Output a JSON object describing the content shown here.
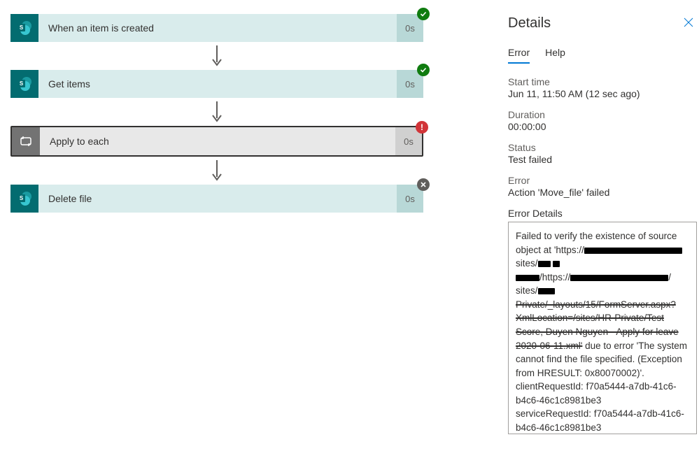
{
  "flow": {
    "steps": [
      {
        "label": "When an item is created",
        "time": "0s",
        "status": "success",
        "icon": "sharepoint"
      },
      {
        "label": "Get items",
        "time": "0s",
        "status": "success",
        "icon": "sharepoint"
      },
      {
        "label": "Apply to each",
        "time": "0s",
        "status": "error",
        "icon": "loop",
        "selected": true
      },
      {
        "label": "Delete file",
        "time": "0s",
        "status": "skipped",
        "icon": "sharepoint"
      }
    ]
  },
  "details": {
    "title": "Details",
    "tabs": {
      "error": "Error",
      "help": "Help",
      "selected": "error"
    },
    "start_time": {
      "label": "Start time",
      "value": "Jun 11, 11:50 AM (12 sec ago)"
    },
    "duration": {
      "label": "Duration",
      "value": "00:00:00"
    },
    "status": {
      "label": "Status",
      "value": "Test failed"
    },
    "error": {
      "label": "Error",
      "value": "Action 'Move_file' failed"
    },
    "error_details_label": "Error Details",
    "error_details": {
      "line1": "Failed to verify the existence of source object at",
      "prefix": "'https://",
      "mid1": "sites/",
      "mid2": "/https://",
      "mid3": "sites/",
      "tail": " due to error 'The system cannot find the file specified. (Exception from HRESULT: 0x80070002)'.",
      "client_req_label": "clientRequestId: ",
      "client_req_id": "f70a5444-a7db-41c6-b4c6-46c1c8981be3",
      "service_req_label": "serviceRequestId: ",
      "service_req_id": "f70a5444-a7db-41c6-b4c6-46c1c8981be3"
    }
  }
}
